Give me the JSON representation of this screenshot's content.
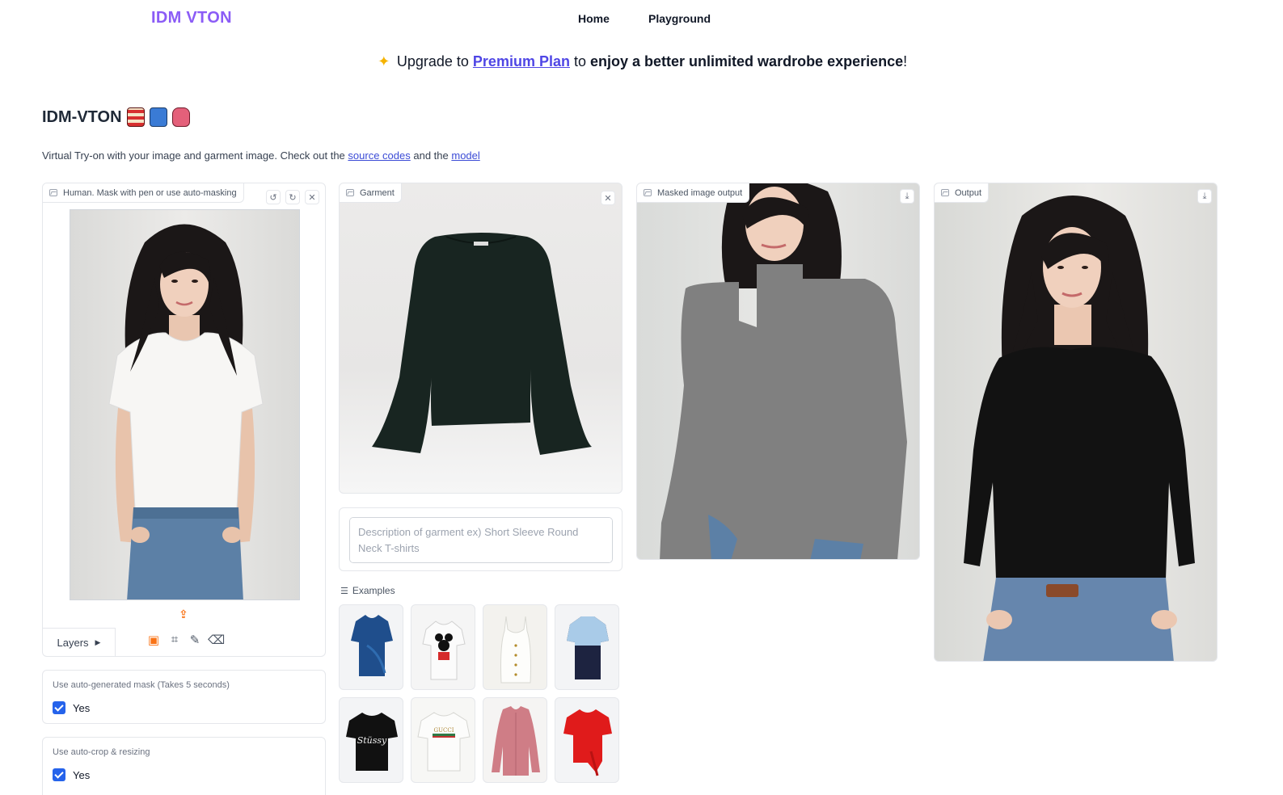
{
  "nav": {
    "brand": "IDM VTON",
    "links": [
      "Home",
      "Playground"
    ]
  },
  "banner": {
    "prefix": "Upgrade to",
    "link": "Premium Plan",
    "middle": "to",
    "bold": "enjoy a better unlimited wardrobe experience",
    "suffix": "!"
  },
  "page": {
    "title": "IDM-VTON",
    "subtitle_prefix": "Virtual Try-on with your image and garment image. Check out the",
    "subtitle_link1": "source codes",
    "subtitle_mid": "and the",
    "subtitle_link2": "model"
  },
  "human_panel": {
    "label": "Human. Mask with pen or use auto-masking",
    "layers_label": "Layers"
  },
  "garment_panel": {
    "label": "Garment",
    "description_placeholder": "Description of garment ex) Short Sleeve Round Neck T-shirts"
  },
  "examples": {
    "label": "Examples",
    "items": [
      {
        "name": "blue-velvet-wrap-top",
        "color": "#1f4e8c"
      },
      {
        "name": "minnie-white-tee",
        "color": "#f4f4f4"
      },
      {
        "name": "white-cami-top",
        "color": "#f1f0ea"
      },
      {
        "name": "navy-lightblue-polo",
        "color": "#1d2340"
      },
      {
        "name": "black-stussy-tee",
        "color": "#111111"
      },
      {
        "name": "white-gucci-tee",
        "color": "#f5f5f3"
      },
      {
        "name": "pink-long-sleeve-shirt",
        "color": "#cf7d86"
      },
      {
        "name": "red-tie-tee",
        "color": "#e01b1b"
      }
    ]
  },
  "masked_panel": {
    "label": "Masked image output"
  },
  "output_panel": {
    "label": "Output"
  },
  "options": [
    {
      "title": "Use auto-generated mask (Takes 5 seconds)",
      "value": "Yes",
      "checked": true
    },
    {
      "title": "Use auto-crop & resizing",
      "value": "Yes",
      "checked": true
    }
  ],
  "colors": {
    "brand": "#8b5cf6",
    "link": "#4f46e5",
    "checkbox": "#2563eb",
    "upload_icon": "#f97316",
    "mask_gray": "#808080"
  }
}
